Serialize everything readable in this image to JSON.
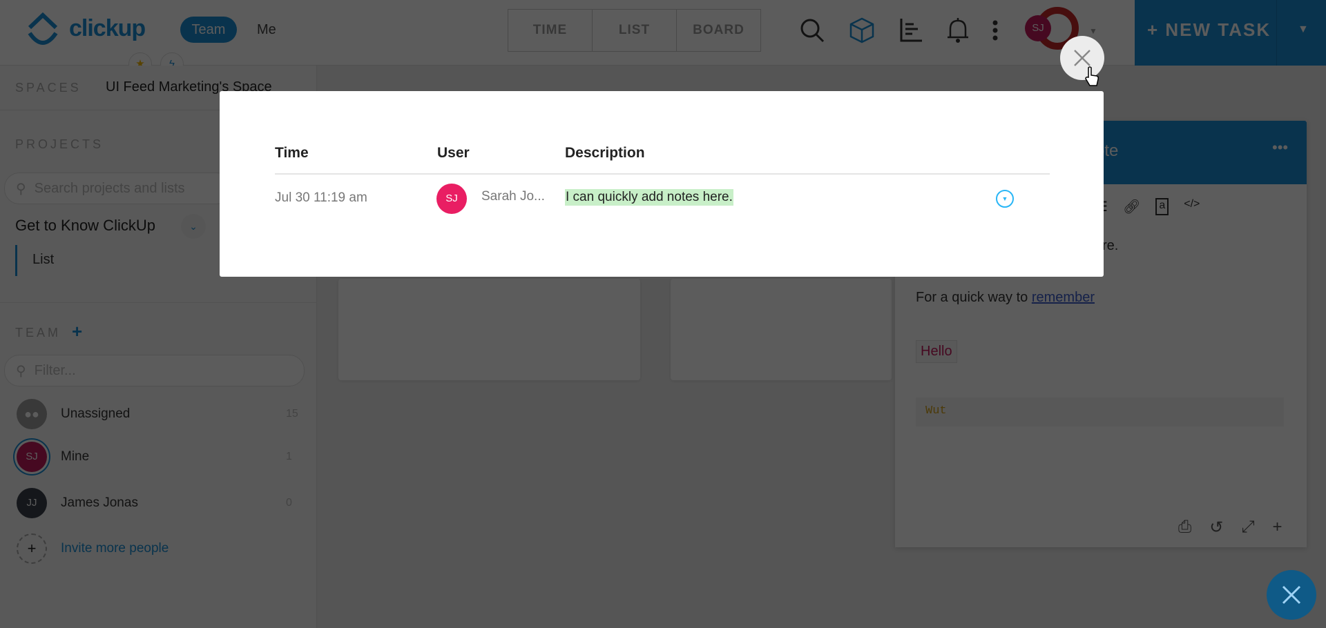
{
  "header": {
    "logo": "clickup",
    "scope_tabs": [
      {
        "label": "Team",
        "active": true
      },
      {
        "label": "Me",
        "active": false
      }
    ],
    "view_tabs": [
      "TIME",
      "LIST",
      "BOARD"
    ],
    "icons": [
      "search-icon",
      "cube-icon",
      "chart-icon",
      "bell-icon",
      "more-vertical-icon"
    ],
    "user_initials": "SJ",
    "new_task_label": "+ NEW TASK",
    "quick_icons": [
      "star-icon",
      "bolt-icon"
    ]
  },
  "sidebar": {
    "spaces_label": "SPACES",
    "space_name": "UI Feed Marketing's Space",
    "projects_label": "PROJECTS",
    "search_placeholder": "Search projects and lists",
    "project_name": "Get to Know ClickUp",
    "list_name": "List",
    "team_label": "TEAM",
    "filter_placeholder": "Filter...",
    "members": [
      {
        "initials": "",
        "name": "Unassigned",
        "count": "15",
        "color": "#9e9e9e"
      },
      {
        "initials": "SJ",
        "name": "Mine",
        "count": "1",
        "color": "#c2185b"
      },
      {
        "initials": "JJ",
        "name": "James Jonas",
        "count": "0",
        "color": "#3a3f4a"
      }
    ],
    "invite_label": "Invite more people"
  },
  "note": {
    "title_fragment": "ote",
    "line1_fragment": "re.",
    "line2_text": "For a quick way to ",
    "line2_link": "remember",
    "hello": "Hello",
    "code": "Wut"
  },
  "modal": {
    "columns": [
      "Time",
      "User",
      "Description"
    ],
    "rows": [
      {
        "time": "Jul 30 11:19 am",
        "user_initials": "SJ",
        "user_name": "Sarah Jo...",
        "description": "I can quickly add notes here."
      }
    ]
  },
  "colors": {
    "brand": "#1a8fd6",
    "avatar_pink": "#e91e63",
    "highlight": "#c8efc8"
  }
}
